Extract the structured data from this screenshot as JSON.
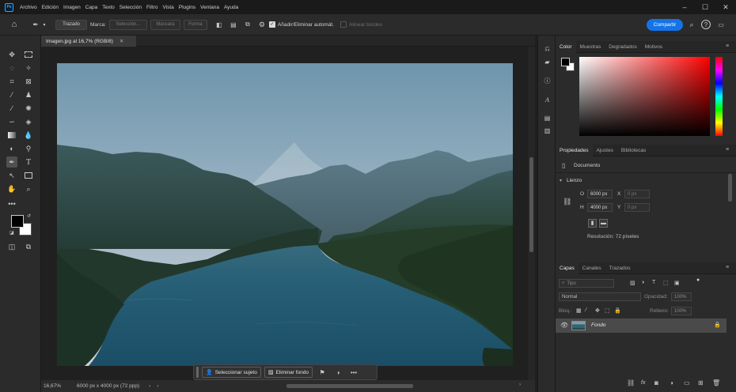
{
  "app": {
    "logo_text": "Ps"
  },
  "menu": [
    "Archivo",
    "Edición",
    "Imagen",
    "Capa",
    "Texto",
    "Selección",
    "Filtro",
    "Vista",
    "Plugins",
    "Ventana",
    "Ayuda"
  ],
  "options": {
    "mode": "Trazado",
    "marca_label": "Marca:",
    "seleccion_label": "Selección...",
    "mascara_label": "Máscara",
    "forma_label": "Forma",
    "autoadd_label": "Añadir/Eliminar automát.",
    "align_label": "Alinear bordes",
    "share_label": "Compartir"
  },
  "document": {
    "tab_title": "Imagen.jpg al 16,7% (RGB/8)",
    "zoom": "16,67%",
    "size": "6000 px x 4000 px (72 ppp)"
  },
  "contextbar": {
    "select_subject": "Seleccionar sujeto",
    "remove_bg": "Eliminar fondo"
  },
  "color_panel": {
    "tabs": [
      "Color",
      "Muestras",
      "Degradados",
      "Motivos"
    ]
  },
  "properties": {
    "tabs": [
      "Propiedades",
      "Ajustes",
      "Bibliotecas"
    ],
    "document_label": "Documento",
    "canvas_title": "Lienzo",
    "w_label": "O",
    "w_value": "6000 px",
    "x_label": "X",
    "x_value": "0 px",
    "h_label": "H",
    "h_value": "4000 px",
    "y_label": "Y",
    "y_value": "0 px",
    "resolution": "Resolución: 72 píxeles"
  },
  "layers": {
    "tabs": [
      "Capas",
      "Canales",
      "Trazados"
    ],
    "filter_placeholder": "Tipo",
    "blend_mode": "Normal",
    "opacity_label": "Opacidad:",
    "opacity_value": "100%",
    "lock_label": "Bloq.:",
    "fill_label": "Relleno:",
    "fill_value": "100%",
    "items": [
      {
        "name": "Fondo"
      }
    ]
  }
}
